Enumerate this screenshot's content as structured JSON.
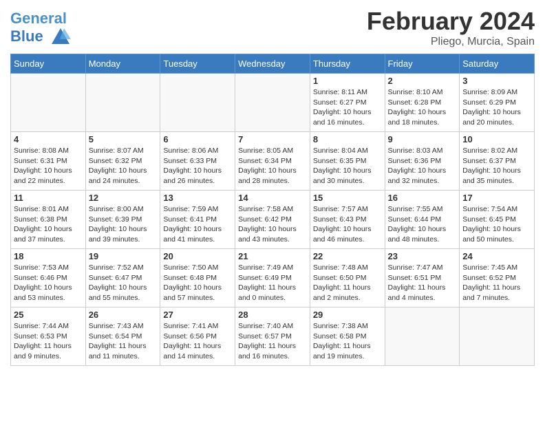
{
  "header": {
    "logo_line1": "General",
    "logo_line2": "Blue",
    "month_title": "February 2024",
    "location": "Pliego, Murcia, Spain"
  },
  "weekdays": [
    "Sunday",
    "Monday",
    "Tuesday",
    "Wednesday",
    "Thursday",
    "Friday",
    "Saturday"
  ],
  "weeks": [
    [
      {
        "day": "",
        "info": ""
      },
      {
        "day": "",
        "info": ""
      },
      {
        "day": "",
        "info": ""
      },
      {
        "day": "",
        "info": ""
      },
      {
        "day": "1",
        "info": "Sunrise: 8:11 AM\nSunset: 6:27 PM\nDaylight: 10 hours\nand 16 minutes."
      },
      {
        "day": "2",
        "info": "Sunrise: 8:10 AM\nSunset: 6:28 PM\nDaylight: 10 hours\nand 18 minutes."
      },
      {
        "day": "3",
        "info": "Sunrise: 8:09 AM\nSunset: 6:29 PM\nDaylight: 10 hours\nand 20 minutes."
      }
    ],
    [
      {
        "day": "4",
        "info": "Sunrise: 8:08 AM\nSunset: 6:31 PM\nDaylight: 10 hours\nand 22 minutes."
      },
      {
        "day": "5",
        "info": "Sunrise: 8:07 AM\nSunset: 6:32 PM\nDaylight: 10 hours\nand 24 minutes."
      },
      {
        "day": "6",
        "info": "Sunrise: 8:06 AM\nSunset: 6:33 PM\nDaylight: 10 hours\nand 26 minutes."
      },
      {
        "day": "7",
        "info": "Sunrise: 8:05 AM\nSunset: 6:34 PM\nDaylight: 10 hours\nand 28 minutes."
      },
      {
        "day": "8",
        "info": "Sunrise: 8:04 AM\nSunset: 6:35 PM\nDaylight: 10 hours\nand 30 minutes."
      },
      {
        "day": "9",
        "info": "Sunrise: 8:03 AM\nSunset: 6:36 PM\nDaylight: 10 hours\nand 32 minutes."
      },
      {
        "day": "10",
        "info": "Sunrise: 8:02 AM\nSunset: 6:37 PM\nDaylight: 10 hours\nand 35 minutes."
      }
    ],
    [
      {
        "day": "11",
        "info": "Sunrise: 8:01 AM\nSunset: 6:38 PM\nDaylight: 10 hours\nand 37 minutes."
      },
      {
        "day": "12",
        "info": "Sunrise: 8:00 AM\nSunset: 6:39 PM\nDaylight: 10 hours\nand 39 minutes."
      },
      {
        "day": "13",
        "info": "Sunrise: 7:59 AM\nSunset: 6:41 PM\nDaylight: 10 hours\nand 41 minutes."
      },
      {
        "day": "14",
        "info": "Sunrise: 7:58 AM\nSunset: 6:42 PM\nDaylight: 10 hours\nand 43 minutes."
      },
      {
        "day": "15",
        "info": "Sunrise: 7:57 AM\nSunset: 6:43 PM\nDaylight: 10 hours\nand 46 minutes."
      },
      {
        "day": "16",
        "info": "Sunrise: 7:55 AM\nSunset: 6:44 PM\nDaylight: 10 hours\nand 48 minutes."
      },
      {
        "day": "17",
        "info": "Sunrise: 7:54 AM\nSunset: 6:45 PM\nDaylight: 10 hours\nand 50 minutes."
      }
    ],
    [
      {
        "day": "18",
        "info": "Sunrise: 7:53 AM\nSunset: 6:46 PM\nDaylight: 10 hours\nand 53 minutes."
      },
      {
        "day": "19",
        "info": "Sunrise: 7:52 AM\nSunset: 6:47 PM\nDaylight: 10 hours\nand 55 minutes."
      },
      {
        "day": "20",
        "info": "Sunrise: 7:50 AM\nSunset: 6:48 PM\nDaylight: 10 hours\nand 57 minutes."
      },
      {
        "day": "21",
        "info": "Sunrise: 7:49 AM\nSunset: 6:49 PM\nDaylight: 11 hours\nand 0 minutes."
      },
      {
        "day": "22",
        "info": "Sunrise: 7:48 AM\nSunset: 6:50 PM\nDaylight: 11 hours\nand 2 minutes."
      },
      {
        "day": "23",
        "info": "Sunrise: 7:47 AM\nSunset: 6:51 PM\nDaylight: 11 hours\nand 4 minutes."
      },
      {
        "day": "24",
        "info": "Sunrise: 7:45 AM\nSunset: 6:52 PM\nDaylight: 11 hours\nand 7 minutes."
      }
    ],
    [
      {
        "day": "25",
        "info": "Sunrise: 7:44 AM\nSunset: 6:53 PM\nDaylight: 11 hours\nand 9 minutes."
      },
      {
        "day": "26",
        "info": "Sunrise: 7:43 AM\nSunset: 6:54 PM\nDaylight: 11 hours\nand 11 minutes."
      },
      {
        "day": "27",
        "info": "Sunrise: 7:41 AM\nSunset: 6:56 PM\nDaylight: 11 hours\nand 14 minutes."
      },
      {
        "day": "28",
        "info": "Sunrise: 7:40 AM\nSunset: 6:57 PM\nDaylight: 11 hours\nand 16 minutes."
      },
      {
        "day": "29",
        "info": "Sunrise: 7:38 AM\nSunset: 6:58 PM\nDaylight: 11 hours\nand 19 minutes."
      },
      {
        "day": "",
        "info": ""
      },
      {
        "day": "",
        "info": ""
      }
    ]
  ]
}
